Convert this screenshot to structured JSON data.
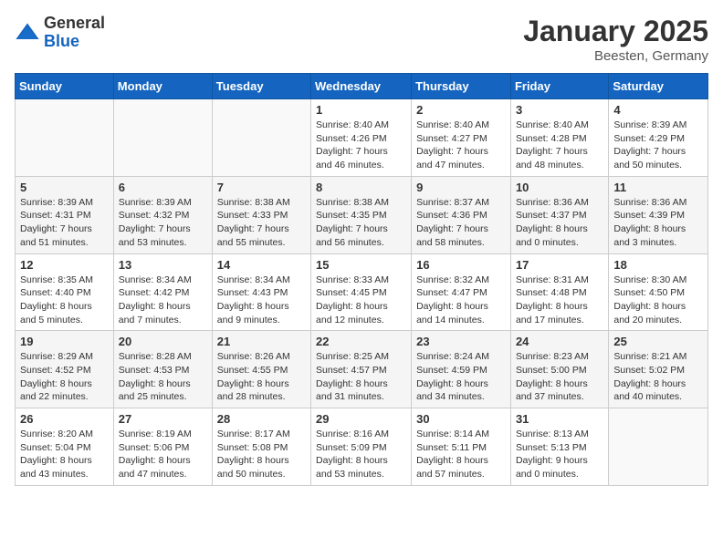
{
  "header": {
    "logo_general": "General",
    "logo_blue": "Blue",
    "month_title": "January 2025",
    "location": "Beesten, Germany"
  },
  "weekdays": [
    "Sunday",
    "Monday",
    "Tuesday",
    "Wednesday",
    "Thursday",
    "Friday",
    "Saturday"
  ],
  "weeks": [
    [
      {
        "day": "",
        "info": ""
      },
      {
        "day": "",
        "info": ""
      },
      {
        "day": "",
        "info": ""
      },
      {
        "day": "1",
        "info": "Sunrise: 8:40 AM\nSunset: 4:26 PM\nDaylight: 7 hours\nand 46 minutes."
      },
      {
        "day": "2",
        "info": "Sunrise: 8:40 AM\nSunset: 4:27 PM\nDaylight: 7 hours\nand 47 minutes."
      },
      {
        "day": "3",
        "info": "Sunrise: 8:40 AM\nSunset: 4:28 PM\nDaylight: 7 hours\nand 48 minutes."
      },
      {
        "day": "4",
        "info": "Sunrise: 8:39 AM\nSunset: 4:29 PM\nDaylight: 7 hours\nand 50 minutes."
      }
    ],
    [
      {
        "day": "5",
        "info": "Sunrise: 8:39 AM\nSunset: 4:31 PM\nDaylight: 7 hours\nand 51 minutes."
      },
      {
        "day": "6",
        "info": "Sunrise: 8:39 AM\nSunset: 4:32 PM\nDaylight: 7 hours\nand 53 minutes."
      },
      {
        "day": "7",
        "info": "Sunrise: 8:38 AM\nSunset: 4:33 PM\nDaylight: 7 hours\nand 55 minutes."
      },
      {
        "day": "8",
        "info": "Sunrise: 8:38 AM\nSunset: 4:35 PM\nDaylight: 7 hours\nand 56 minutes."
      },
      {
        "day": "9",
        "info": "Sunrise: 8:37 AM\nSunset: 4:36 PM\nDaylight: 7 hours\nand 58 minutes."
      },
      {
        "day": "10",
        "info": "Sunrise: 8:36 AM\nSunset: 4:37 PM\nDaylight: 8 hours\nand 0 minutes."
      },
      {
        "day": "11",
        "info": "Sunrise: 8:36 AM\nSunset: 4:39 PM\nDaylight: 8 hours\nand 3 minutes."
      }
    ],
    [
      {
        "day": "12",
        "info": "Sunrise: 8:35 AM\nSunset: 4:40 PM\nDaylight: 8 hours\nand 5 minutes."
      },
      {
        "day": "13",
        "info": "Sunrise: 8:34 AM\nSunset: 4:42 PM\nDaylight: 8 hours\nand 7 minutes."
      },
      {
        "day": "14",
        "info": "Sunrise: 8:34 AM\nSunset: 4:43 PM\nDaylight: 8 hours\nand 9 minutes."
      },
      {
        "day": "15",
        "info": "Sunrise: 8:33 AM\nSunset: 4:45 PM\nDaylight: 8 hours\nand 12 minutes."
      },
      {
        "day": "16",
        "info": "Sunrise: 8:32 AM\nSunset: 4:47 PM\nDaylight: 8 hours\nand 14 minutes."
      },
      {
        "day": "17",
        "info": "Sunrise: 8:31 AM\nSunset: 4:48 PM\nDaylight: 8 hours\nand 17 minutes."
      },
      {
        "day": "18",
        "info": "Sunrise: 8:30 AM\nSunset: 4:50 PM\nDaylight: 8 hours\nand 20 minutes."
      }
    ],
    [
      {
        "day": "19",
        "info": "Sunrise: 8:29 AM\nSunset: 4:52 PM\nDaylight: 8 hours\nand 22 minutes."
      },
      {
        "day": "20",
        "info": "Sunrise: 8:28 AM\nSunset: 4:53 PM\nDaylight: 8 hours\nand 25 minutes."
      },
      {
        "day": "21",
        "info": "Sunrise: 8:26 AM\nSunset: 4:55 PM\nDaylight: 8 hours\nand 28 minutes."
      },
      {
        "day": "22",
        "info": "Sunrise: 8:25 AM\nSunset: 4:57 PM\nDaylight: 8 hours\nand 31 minutes."
      },
      {
        "day": "23",
        "info": "Sunrise: 8:24 AM\nSunset: 4:59 PM\nDaylight: 8 hours\nand 34 minutes."
      },
      {
        "day": "24",
        "info": "Sunrise: 8:23 AM\nSunset: 5:00 PM\nDaylight: 8 hours\nand 37 minutes."
      },
      {
        "day": "25",
        "info": "Sunrise: 8:21 AM\nSunset: 5:02 PM\nDaylight: 8 hours\nand 40 minutes."
      }
    ],
    [
      {
        "day": "26",
        "info": "Sunrise: 8:20 AM\nSunset: 5:04 PM\nDaylight: 8 hours\nand 43 minutes."
      },
      {
        "day": "27",
        "info": "Sunrise: 8:19 AM\nSunset: 5:06 PM\nDaylight: 8 hours\nand 47 minutes."
      },
      {
        "day": "28",
        "info": "Sunrise: 8:17 AM\nSunset: 5:08 PM\nDaylight: 8 hours\nand 50 minutes."
      },
      {
        "day": "29",
        "info": "Sunrise: 8:16 AM\nSunset: 5:09 PM\nDaylight: 8 hours\nand 53 minutes."
      },
      {
        "day": "30",
        "info": "Sunrise: 8:14 AM\nSunset: 5:11 PM\nDaylight: 8 hours\nand 57 minutes."
      },
      {
        "day": "31",
        "info": "Sunrise: 8:13 AM\nSunset: 5:13 PM\nDaylight: 9 hours\nand 0 minutes."
      },
      {
        "day": "",
        "info": ""
      }
    ]
  ]
}
